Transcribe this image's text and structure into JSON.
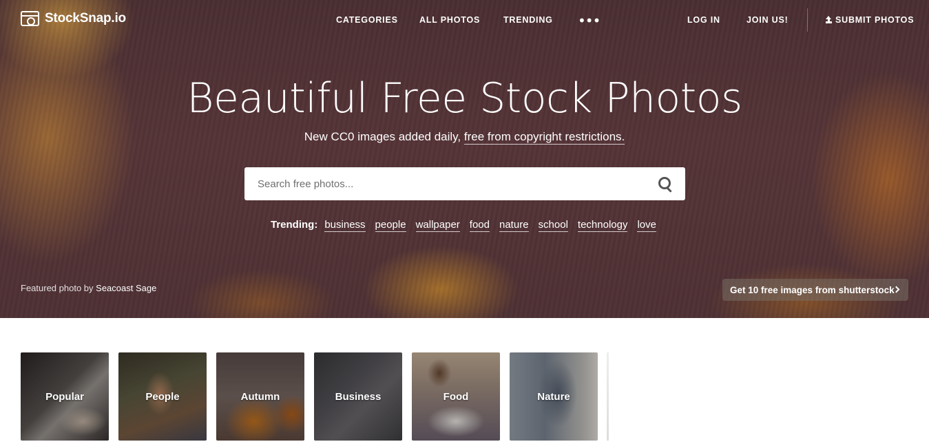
{
  "brand": {
    "name": "StockSnap.io"
  },
  "nav": {
    "categories": "CATEGORIES",
    "all_photos": "ALL PHOTOS",
    "trending": "TRENDING",
    "more": "•••",
    "login": "LOG IN",
    "join": "JOIN US!",
    "submit": "SUBMIT PHOTOS"
  },
  "hero": {
    "title": "Beautiful Free Stock Photos",
    "subtitle_prefix": "New CC0 images added daily,",
    "subtitle_link": "free from copyright restrictions.",
    "search_placeholder": "Search free photos...",
    "trending_label": "Trending:",
    "trending_tags": [
      "business",
      "people",
      "wallpaper",
      "food",
      "nature",
      "school",
      "technology",
      "love"
    ],
    "credit_prefix": "Featured photo by",
    "credit_name": "Seacoast Sage",
    "promo": "Get 10 free images from shutterstock"
  },
  "categories": [
    "Popular",
    "People",
    "Autumn",
    "Business",
    "Food",
    "Nature"
  ],
  "icons": [
    "camera-logo-icon",
    "more-dots-icon",
    "upload-icon",
    "search-icon",
    "chevron-right-icon"
  ]
}
